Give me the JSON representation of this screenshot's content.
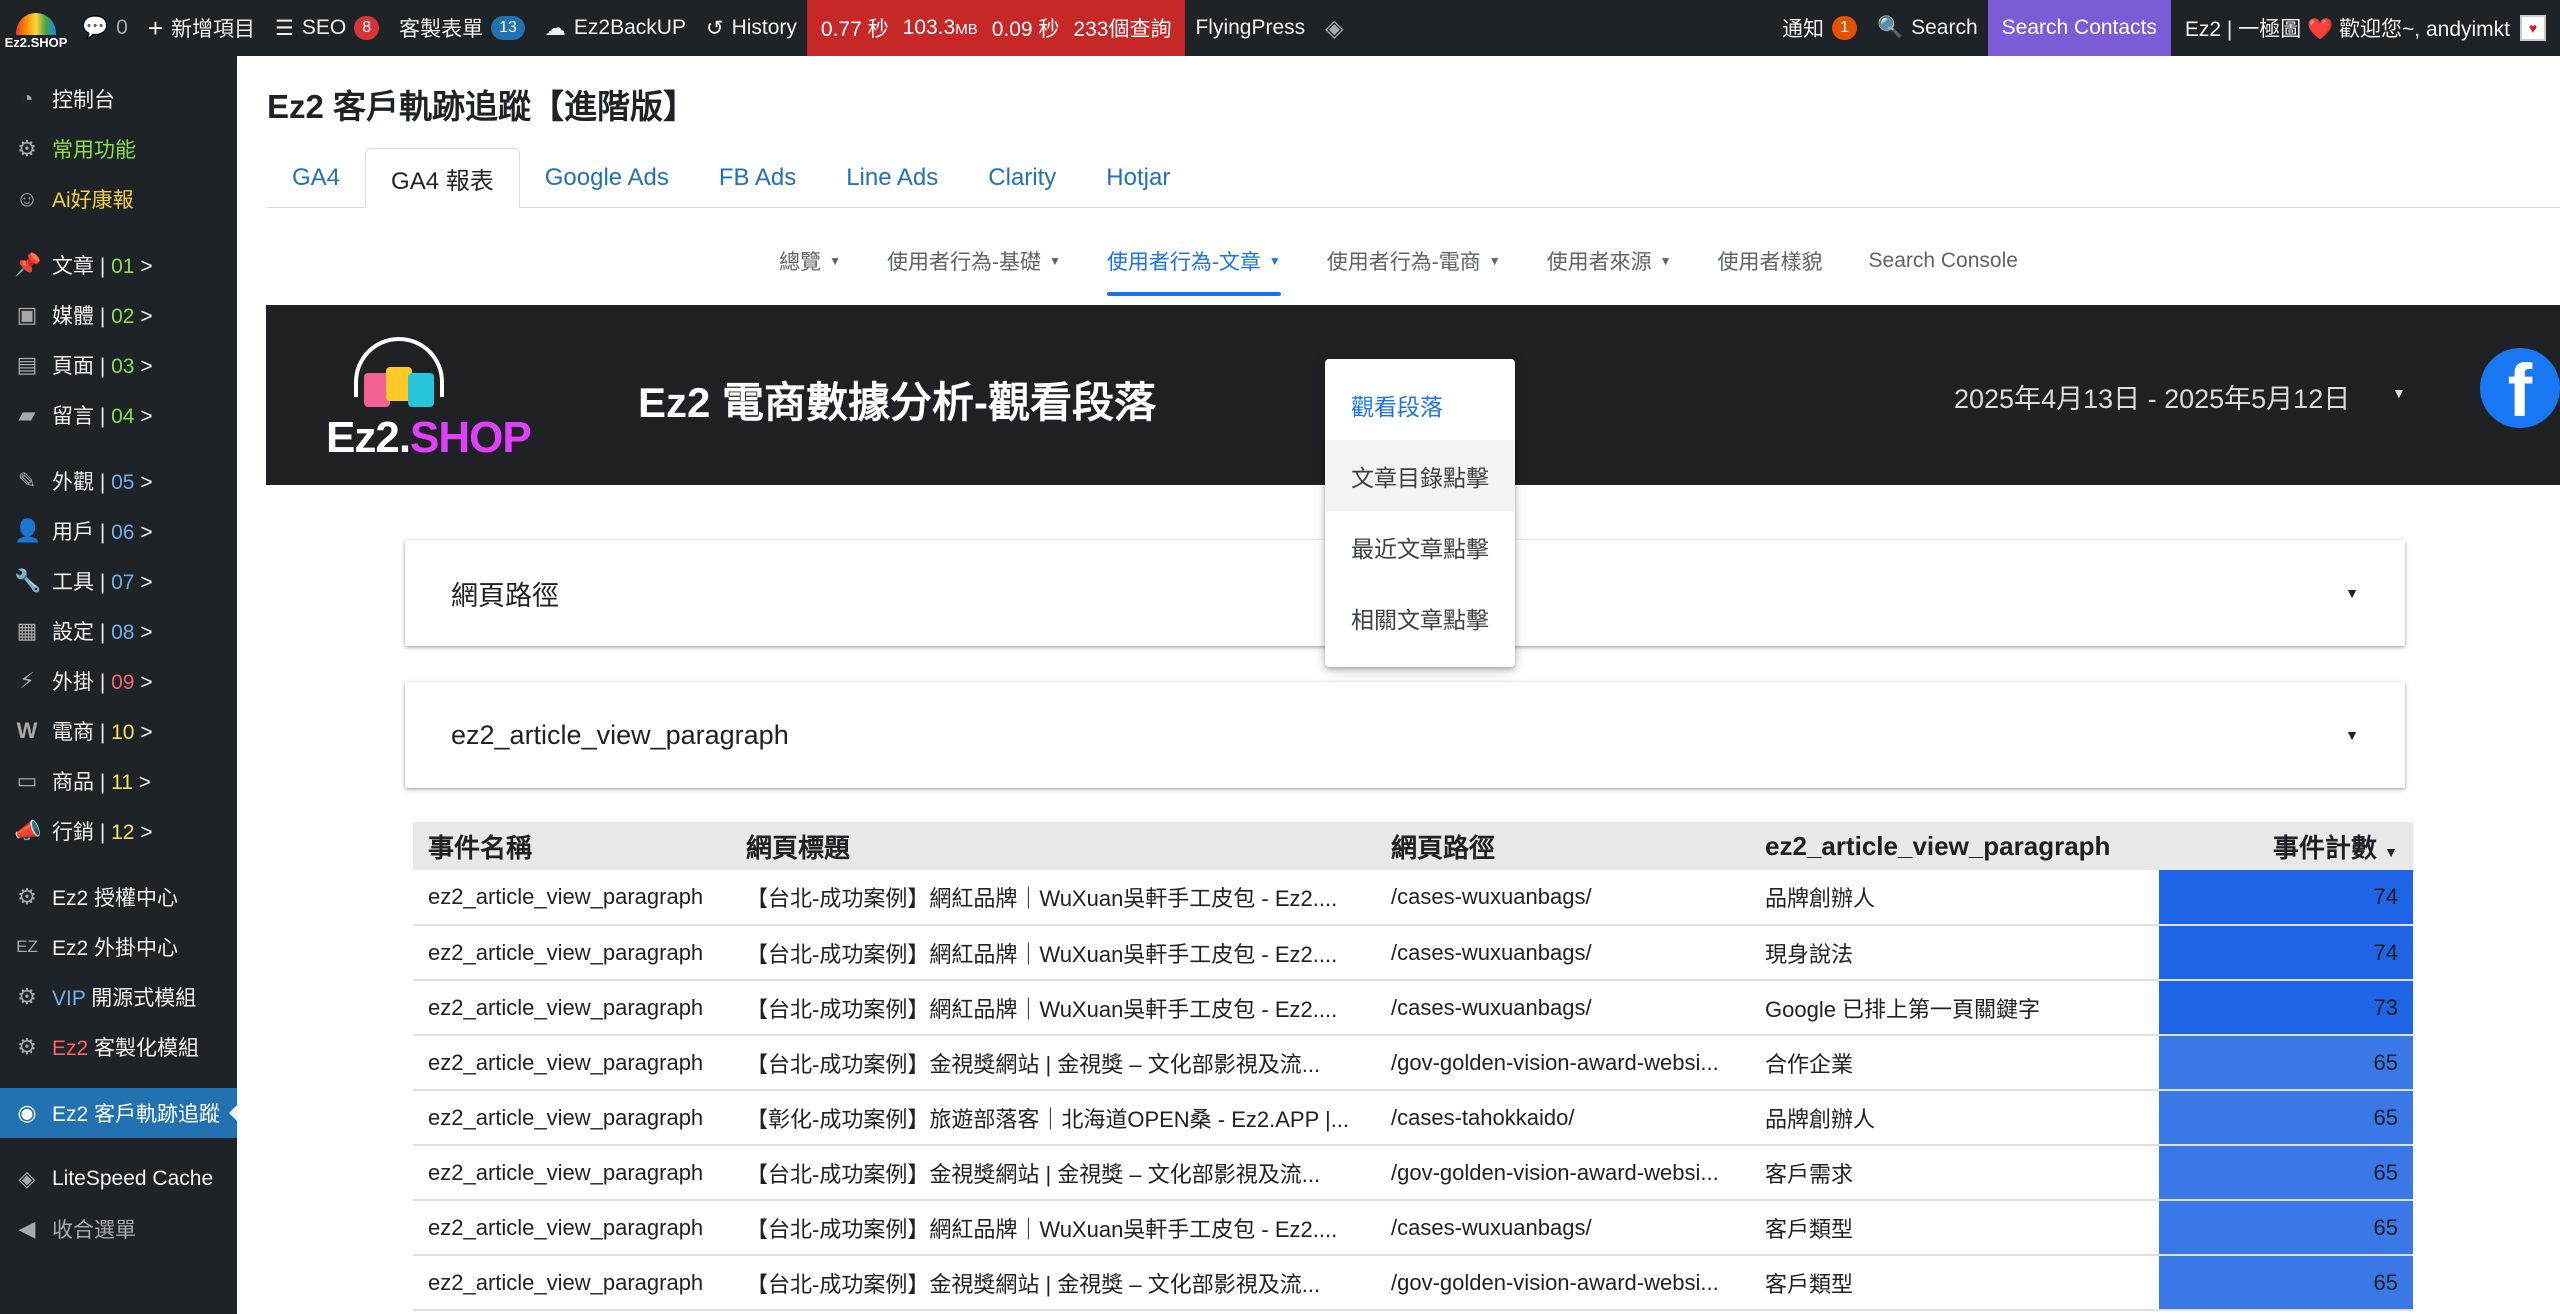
{
  "adminbar": {
    "logo_text": "Ez2.SHOP",
    "comments_count": "0",
    "new_item": "新增項目",
    "seo_label": "SEO",
    "seo_count": "8",
    "forms_label": "客製表單",
    "forms_count": "13",
    "backup_label": "Ez2BackUP",
    "history_label": "History",
    "perf_time": "0.77 秒",
    "perf_mem": "103.3",
    "perf_mem_unit": "MB",
    "perf_query_time": "0.09 秒",
    "perf_queries": "233個查詢",
    "flyingpress": "FlyingPress",
    "notify_label": "通知",
    "notify_count": "1",
    "search_label": "Search",
    "search_contacts": "Search Contacts",
    "greeting": "Ez2 | 一極圖 ❤️ 歡迎您~, andyimkt"
  },
  "sidebar": {
    "dashboard": "控制台",
    "common": "常用功能",
    "ai_news": "Ai好康報",
    "posts": {
      "label": "文章 | ",
      "num": "01",
      "arrow": " >"
    },
    "media": {
      "label": "媒體 | ",
      "num": "02",
      "arrow": " >"
    },
    "pages": {
      "label": "頁面 | ",
      "num": "03",
      "arrow": " >"
    },
    "comments": {
      "label": "留言 | ",
      "num": "04",
      "arrow": " >"
    },
    "appearance": {
      "label": "外觀 | ",
      "num": "05",
      "arrow": " >"
    },
    "users": {
      "label": "用戶 | ",
      "num": "06",
      "arrow": " >"
    },
    "tools": {
      "label": "工具 | ",
      "num": "07",
      "arrow": " >"
    },
    "settings": {
      "label": "設定 | ",
      "num": "08",
      "arrow": " >"
    },
    "plugins": {
      "label": "外掛 | ",
      "num": "09",
      "arrow": " >"
    },
    "commerce": {
      "label": "電商 | ",
      "num": "10",
      "arrow": " >"
    },
    "products": {
      "label": "商品 | ",
      "num": "11",
      "arrow": " >"
    },
    "marketing": {
      "label": "行銷 | ",
      "num": "12",
      "arrow": " >"
    },
    "license": "Ez2 授權中心",
    "plugins_center": "Ez2 外掛中心",
    "vip_prefix": "VIP",
    "vip_label": " 開源式模組",
    "custom_prefix": "Ez2",
    "custom_label": " 客製化模組",
    "tracking": "Ez2 客戶軌跡追蹤",
    "litespeed": "LiteSpeed Cache",
    "collapse": "收合選單"
  },
  "main": {
    "title": "Ez2 客戶軌跡追蹤【進階版】",
    "tabs": [
      "GA4",
      "GA4 報表",
      "Google Ads",
      "FB Ads",
      "Line Ads",
      "Clarity",
      "Hotjar"
    ],
    "subnav": [
      "總覽",
      "使用者行為-基礎",
      "使用者行為-文章",
      "使用者行為-電商",
      "使用者來源",
      "使用者樣貌",
      "Search Console"
    ],
    "dropdown": [
      "觀看段落",
      "文章目錄點擊",
      "最近文章點擊",
      "相關文章點擊"
    ],
    "banner_title": "Ez2 電商數據分析-觀看段落",
    "banner_logo": "Ez2.SHOP",
    "date_range": "2025年4月13日 - 2025年5月12日",
    "filter1": "網頁路徑",
    "filter2": "ez2_article_view_paragraph"
  },
  "table": {
    "headers": [
      "事件名稱",
      "網頁標題",
      "網頁路徑",
      "ez2_article_view_paragraph",
      "事件計數"
    ],
    "rows": [
      [
        "ez2_article_view_paragraph",
        "【台北-成功案例】網紅品牌｜WuXuan吳軒手工皮包 - Ez2....",
        "/cases-wuxuanbags/",
        "品牌創辦人",
        "74"
      ],
      [
        "ez2_article_view_paragraph",
        "【台北-成功案例】網紅品牌｜WuXuan吳軒手工皮包 - Ez2....",
        "/cases-wuxuanbags/",
        "現身說法",
        "74"
      ],
      [
        "ez2_article_view_paragraph",
        "【台北-成功案例】網紅品牌｜WuXuan吳軒手工皮包 - Ez2....",
        "/cases-wuxuanbags/",
        "Google 已排上第一頁關鍵字",
        "73"
      ],
      [
        "ez2_article_view_paragraph",
        "【台北-成功案例】金視獎網站 | 金視獎 – 文化部影視及流...",
        "/gov-golden-vision-award-websi...",
        "合作企業",
        "65"
      ],
      [
        "ez2_article_view_paragraph",
        "【彰化-成功案例】旅遊部落客｜北海道OPEN桑 - Ez2.APP |...",
        "/cases-tahokkaido/",
        "品牌創辦人",
        "65"
      ],
      [
        "ez2_article_view_paragraph",
        "【台北-成功案例】金視獎網站 | 金視獎 – 文化部影視及流...",
        "/gov-golden-vision-award-websi...",
        "客戶需求",
        "65"
      ],
      [
        "ez2_article_view_paragraph",
        "【台北-成功案例】網紅品牌｜WuXuan吳軒手工皮包 - Ez2....",
        "/cases-wuxuanbags/",
        "客戶類型",
        "65"
      ],
      [
        "ez2_article_view_paragraph",
        "【台北-成功案例】金視獎網站 | 金視獎 – 文化部影視及流...",
        "/gov-golden-vision-award-websi...",
        "客戶類型",
        "65"
      ]
    ]
  },
  "colors": {
    "admin_bg": "#1d2327",
    "accent_blue": "#1a73e8",
    "perf_red": "#c62828",
    "search_contacts_purple": "#7b5cd6",
    "bar_blue": "#3b78e7",
    "facebook_blue": "#1877f2"
  }
}
